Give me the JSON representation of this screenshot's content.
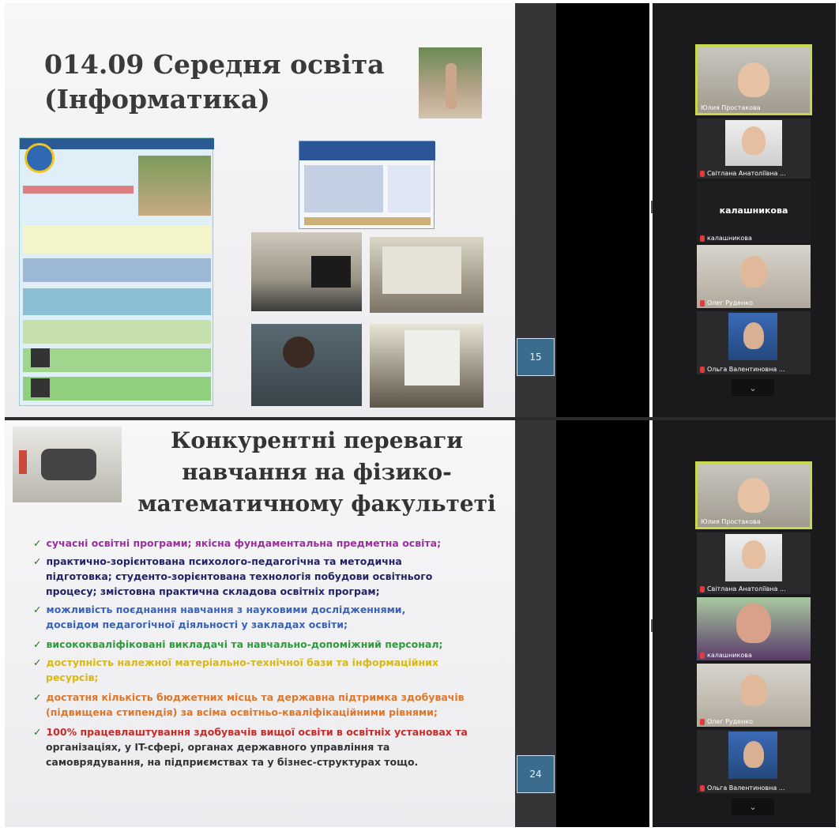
{
  "slide1": {
    "title_line1": "014.09 Середня освіта",
    "title_line2": "(Інформатика)",
    "page_number": "15"
  },
  "slide2": {
    "title_line1": "Конкурентні переваги",
    "title_line2": "навчання на фізико-",
    "title_line3": "математичному факультеті",
    "page_number": "24",
    "bullets": [
      "сучасні освітні програми;  якісна фундаментальна предметна освіта;",
      "практично-зорієнтована психолого-педагогічна та методична",
      "підготовка; студенто-зорієнтована  технологія побудови освітнього",
      "процесу; змістовна практична складова освітніх програм;",
      "можливість поєднання навчання з науковими дослідженнями,",
      "досвідом педагогічної діяльності у закладах освіти;",
      "висококваліфіковані викладачі та навчально-допоміжний персонал;",
      "доступність належної матеріально-технічної бази та інформаційних",
      "ресурсів;",
      "достатня кількість бюджетних місць та державна підтримка здобувачів",
      "(підвищена стипендія) за всіма освітньо-кваліфікаційними рівнями;",
      "100% працевлаштування здобувачів вищої освіти в освітніх установах та",
      "організаціях, у IT-сфері, органах державного управління та",
      "самоврядування, на підприємствах та у бізнес-структурах тощо."
    ],
    "colors": {
      "b1": "#9b2fa0",
      "b2": "#222266",
      "b3": "#3a63b8",
      "b4": "#2e9c3a",
      "b5": "#e0c21a",
      "b6": "#e0762a",
      "b7": "#c82a2a"
    }
  },
  "participants_top": [
    {
      "name": "Юлия Простакова"
    },
    {
      "name": "Світлана Анатоліївна ..."
    },
    {
      "name": "калашникова",
      "label": "калашникова"
    },
    {
      "name": "Олег Руденко"
    },
    {
      "name": "Ольга Валентиновна ..."
    }
  ],
  "participants_bottom": [
    {
      "name": "Юлия Простакова"
    },
    {
      "name": "Світлана Анатоліївна ..."
    },
    {
      "name": "калашникова"
    },
    {
      "name": "Олег Руденко"
    },
    {
      "name": "Ольга Валентиновна ..."
    }
  ],
  "chevron": "⌄",
  "colors": {
    "active_speaker_border": "#c8d84a"
  }
}
